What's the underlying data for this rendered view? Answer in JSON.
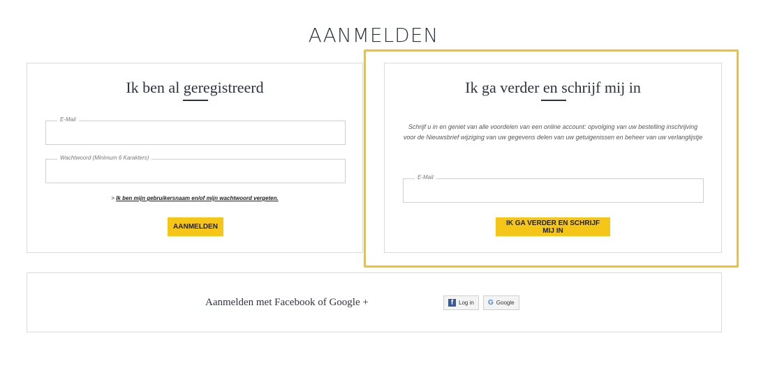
{
  "page": {
    "title": "AANMELDEN"
  },
  "login": {
    "title": "Ik ben al geregistreerd",
    "email_label": "E-Mail",
    "email_value": "",
    "password_label": "Wachtwoord (Minimum 6 Karakters)",
    "password_value": "",
    "forgot_prefix": ">",
    "forgot_link": "Ik ben mijn gebruikersnaam en/of mijn wachtwoord vergeten.",
    "submit_label": "AANMELDEN"
  },
  "register": {
    "title": "Ik ga verder en schrijf mij in",
    "info": "Schrijf u in en geniet van alle voordelen van een online account: opvolging van uw bestelling inschrijving voor de Nieuwsbrief wijziging van uw gegevens delen van uw getuigenissen en beheer van uw verlanglijstje",
    "email_label": "E-Mail",
    "email_value": "",
    "submit_label": "IK GA VERDER EN SCHRIJF MIJ IN"
  },
  "social": {
    "label": "Aanmelden met Facebook of Google +",
    "facebook_label": "Log in",
    "google_label": "Google"
  },
  "colors": {
    "accent": "#f5c518",
    "highlight": "#f3c21f",
    "text": "#2c3340",
    "facebook": "#3b5998"
  },
  "icons": {
    "facebook": "facebook-icon",
    "google": "google-icon"
  }
}
